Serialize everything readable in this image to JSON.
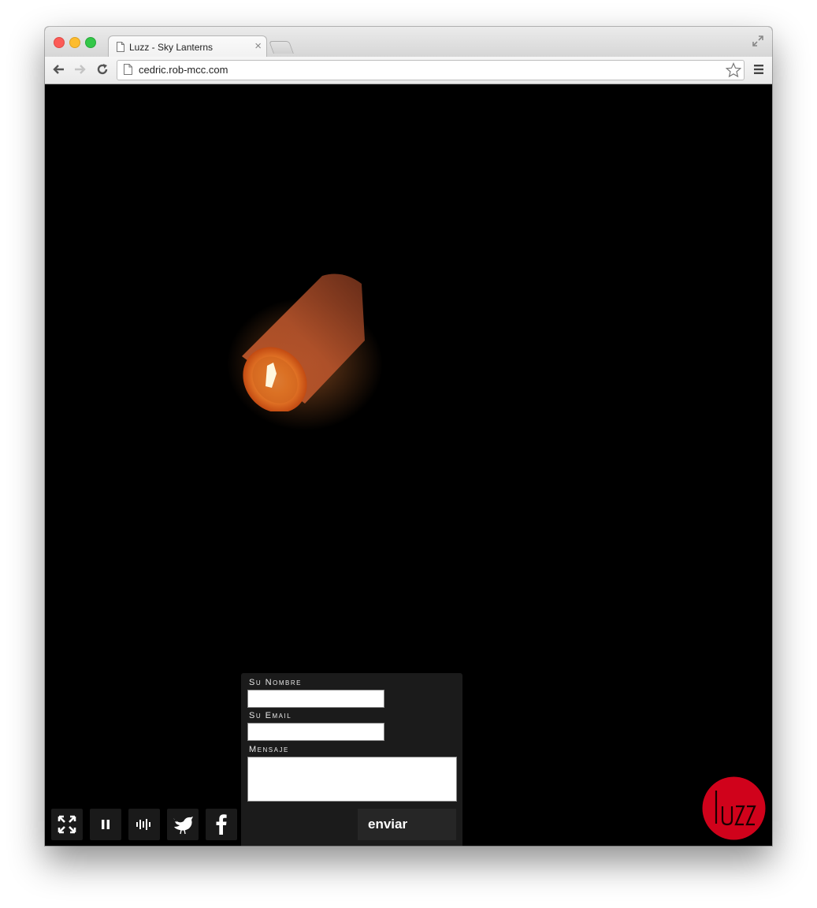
{
  "browser": {
    "tab_title": "Luzz - Sky Lanterns",
    "url": "cedric.rob-mcc.com"
  },
  "form": {
    "name_label": "Su Nombre",
    "email_label": "Su Email",
    "message_label": "Mensaje",
    "name_value": "",
    "email_value": "",
    "message_value": "",
    "submit_label": "enviar"
  },
  "controls": [
    "fullscreen-icon",
    "pause-icon",
    "sound-icon",
    "twitter-icon",
    "facebook-icon",
    "mail-icon"
  ],
  "logo": {
    "text": "luzz",
    "color": "#d0021b"
  }
}
